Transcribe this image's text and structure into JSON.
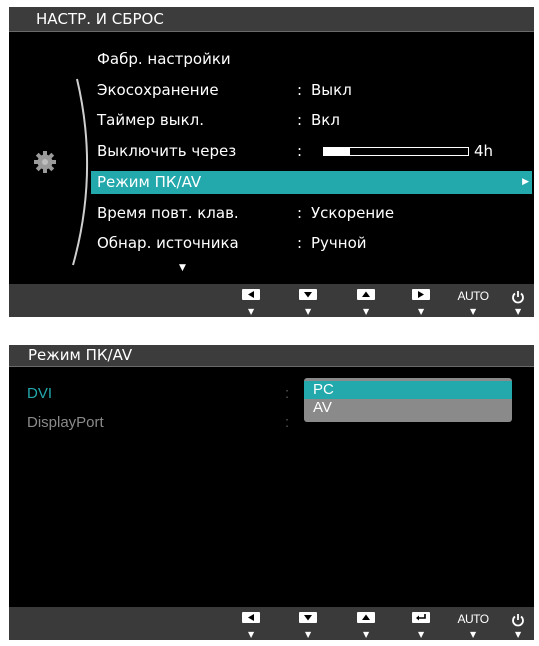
{
  "panel1": {
    "title": "НАСТР. И СБРОС",
    "items": [
      {
        "label": "Фабр. настройки",
        "value": ""
      },
      {
        "label": "Экосохранение",
        "value": "Выкл"
      },
      {
        "label": "Таймер выкл.",
        "value": "Вкл"
      },
      {
        "label": "Выключить через",
        "value": ""
      },
      {
        "label": "Режим ПК/AV",
        "value": ""
      },
      {
        "label": "Время повт. клав.",
        "value": "Ускорение"
      },
      {
        "label": "Обнар. источника",
        "value": "Ручной"
      }
    ],
    "slider": {
      "value_text": "4h",
      "fill_fraction": 0.18
    },
    "selected_index": 4,
    "nav": {
      "auto_label": "AUTO"
    }
  },
  "panel2": {
    "title": "Режим ПК/AV",
    "items": [
      {
        "label": "DVI"
      },
      {
        "label": "DisplayPort"
      }
    ],
    "dropdown": {
      "options": [
        "PC",
        "AV"
      ],
      "selected": "PC"
    },
    "nav": {
      "auto_label": "AUTO"
    }
  },
  "colors": {
    "accent": "#23a8ac",
    "inactive_text": "#8a8a8a"
  },
  "icons": [
    "gear-icon",
    "left-key-icon",
    "down-key-icon",
    "up-key-icon",
    "right-key-icon",
    "enter-key-icon",
    "power-icon"
  ]
}
